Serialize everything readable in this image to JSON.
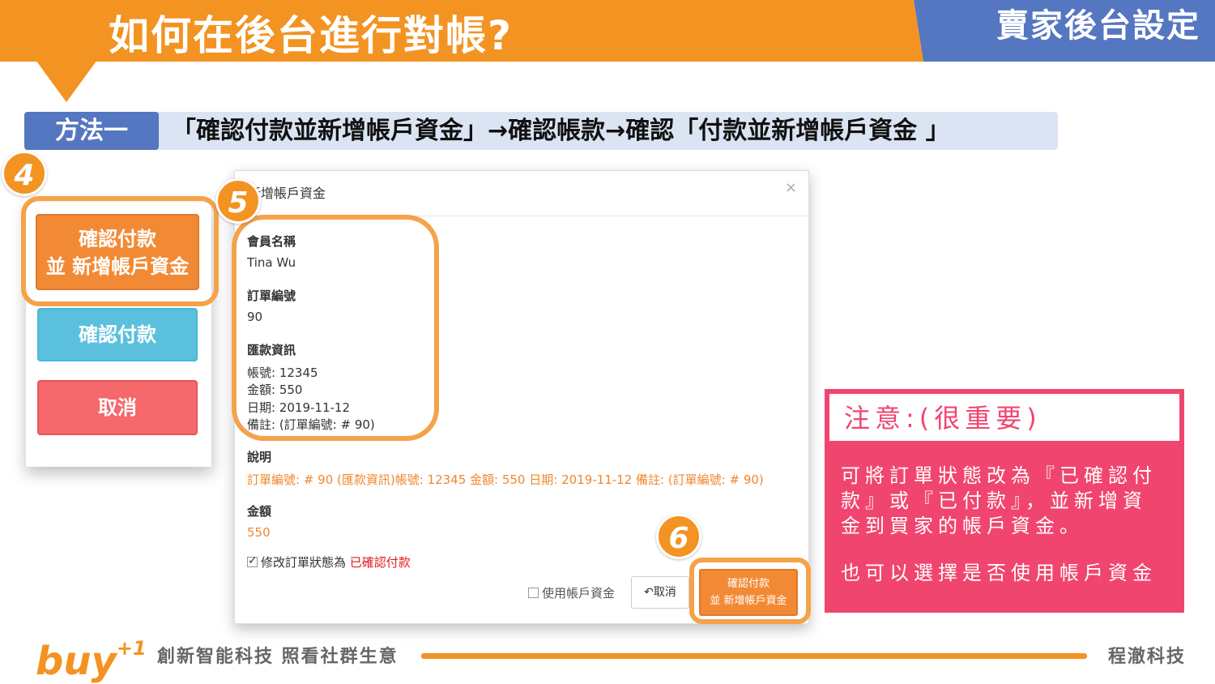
{
  "header": {
    "title": "如何在後台進行對帳?",
    "section": "賣家後台設定"
  },
  "method": {
    "tag": "方法一",
    "description": "「確認付款並新增帳戶資金」→確認帳款→確認「付款並新增帳戶資金 」"
  },
  "steps": [
    "4",
    "5",
    "6"
  ],
  "left_panel": {
    "confirm_add_line1": "確認付款",
    "confirm_add_line2": "並 新增帳戶資金",
    "confirm_pay": "確認付款",
    "cancel": "取消"
  },
  "modal": {
    "title": "新增帳戶資金",
    "close": "×",
    "member_label": "會員名稱",
    "member_value": "Tina Wu",
    "order_label": "訂單編號",
    "order_value": "90",
    "remit_label": "匯款資訊",
    "remit_account": "帳號: 12345",
    "remit_amount": "金額: 550",
    "remit_date": "日期: 2019-11-12",
    "remit_note": "備註: (訂單編號: # 90)",
    "desc_label": "說明",
    "desc_value": "訂單編號: # 90 (匯款資訊)帳號: 12345 金額: 550 日期: 2019-11-12 備註: (訂單編號: # 90)",
    "amount_label": "金額",
    "amount_value": "550",
    "status_prefix": "修改訂單狀態為",
    "status_value": "已確認付款",
    "use_fund": "使用帳戶資金",
    "cancel": "取消",
    "submit_line1": "確認付款",
    "submit_line2": "並 新增帳戶資金"
  },
  "note": {
    "title": "注意:(很重要)",
    "body": "可將訂單狀態改為『已確認付款』或『已付款』，並新增資金到買家的帳戶資金。",
    "body2": "也可以選擇是否使用帳戶資金"
  },
  "footer": {
    "logo": "buy",
    "logo_sup": "+1",
    "slogan": "創新智能科技 照看社群生意",
    "company": "程澈科技"
  },
  "colors": {
    "orange": "#f39322",
    "blue": "#5576c0",
    "info": "#5bc0de",
    "danger": "#f5686b",
    "note": "#f0456f"
  }
}
